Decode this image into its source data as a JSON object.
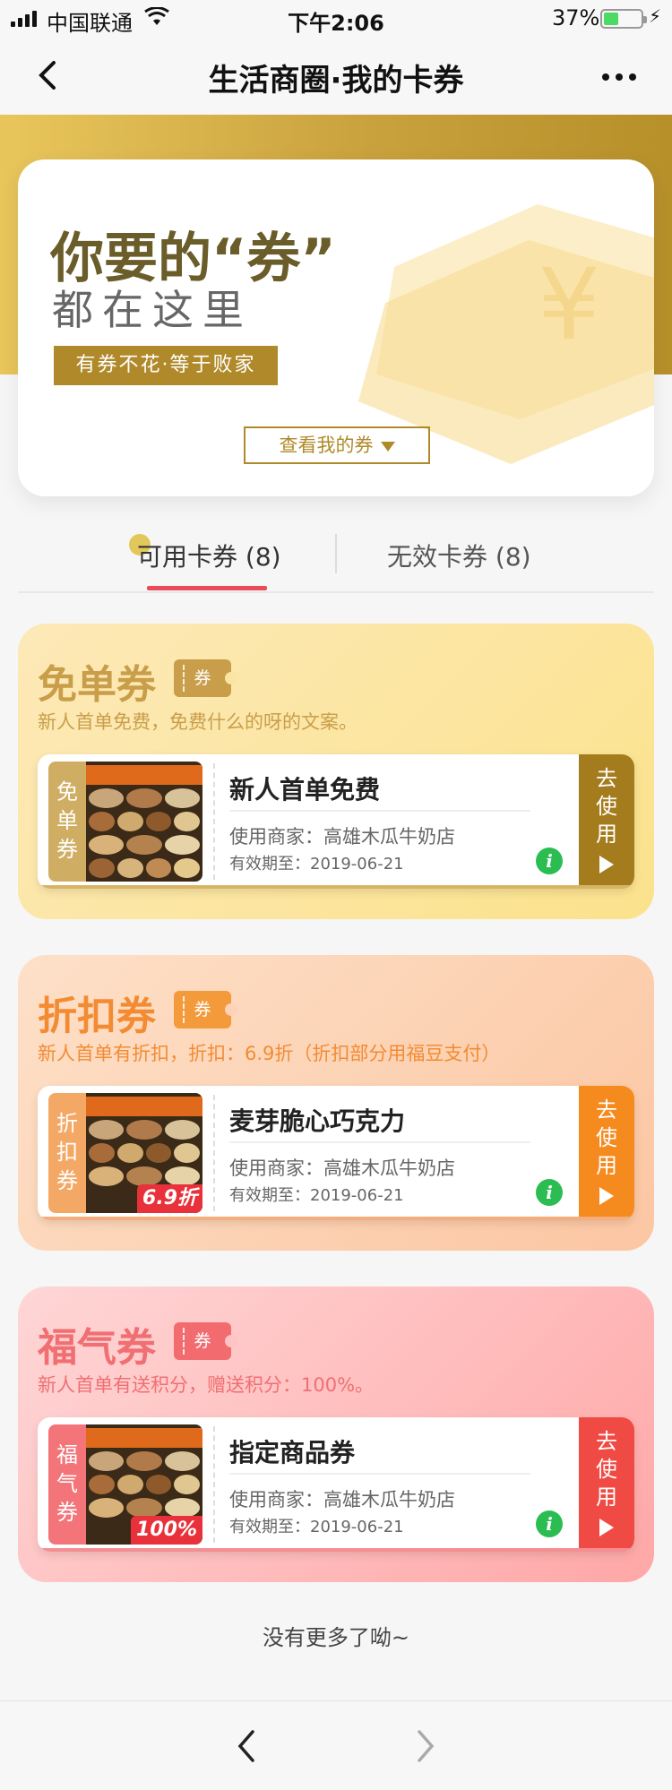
{
  "status_bar": {
    "carrier": "中国联通",
    "time": "下午2:06",
    "battery": "37%",
    "battery_level": 0.37
  },
  "nav": {
    "title": "生活商圈·我的卡券"
  },
  "banner": {
    "headline": "你要的“券”",
    "subline": "都在这里",
    "tag": "有券不花·等于败家",
    "view_button": "查看我的券"
  },
  "tabs": [
    {
      "label": "可用卡券 (8)",
      "active": true
    },
    {
      "label": "无效卡券 (8)",
      "active": false
    }
  ],
  "sections": [
    {
      "title": "免单券",
      "badge": "券",
      "subtitle": "新人首单免费，免费什么的呀的文案。",
      "card": {
        "side_label": "免单券",
        "name": "新人首单免费",
        "merchant": "使用商家：高雄木瓜牛奶店",
        "expiry": "有效期至：2019-06-21",
        "thumb_badge": "",
        "info": "i",
        "use_label": "去使用"
      }
    },
    {
      "title": "折扣券",
      "badge": "券",
      "subtitle": "新人首单有折扣，折扣：6.9折（折扣部分用福豆支付）",
      "card": {
        "side_label": "折扣券",
        "name": "麦芽脆心巧克力",
        "merchant": "使用商家：高雄木瓜牛奶店",
        "expiry": "有效期至：2019-06-21",
        "thumb_badge": "6.9折",
        "info": "i",
        "use_label": "去使用"
      }
    },
    {
      "title": "福气券",
      "badge": "券",
      "subtitle": "新人首单有送积分，赠送积分：100%。",
      "card": {
        "side_label": "福气券",
        "name": "指定商品券",
        "merchant": "使用商家：高雄木瓜牛奶店",
        "expiry": "有效期至：2019-06-21",
        "thumb_badge": "100%",
        "info": "i",
        "use_label": "去使用"
      }
    }
  ],
  "footer_text": "没有更多了呦~",
  "icons": {
    "back": "chevron-left-icon",
    "more": "more-dots-icon",
    "info": "info-icon",
    "play": "play-icon",
    "forward": "chevron-right-icon"
  },
  "colors": {
    "accent_gold": "#b08a2a",
    "tab_underline": "#e94b5a",
    "free_coupon": "#c99e4a",
    "discount_coupon": "#f38b33",
    "luck_coupon": "#f06f73",
    "info_green": "#2bbd52"
  }
}
